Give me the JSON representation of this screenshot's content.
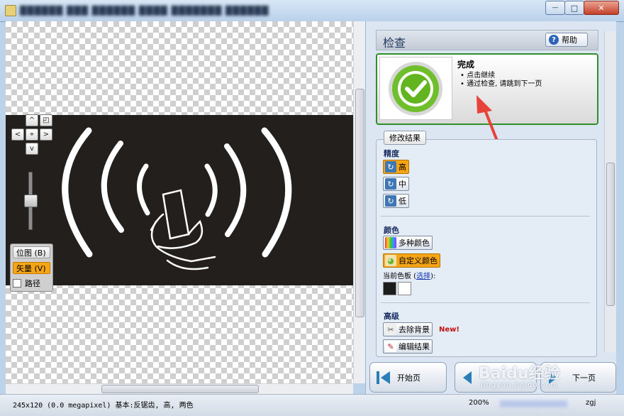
{
  "window": {
    "title": "██████ ███ ██████ ████ ███████ ██████",
    "controls": {
      "minimize": "—",
      "maximize": "□",
      "close": "✕"
    }
  },
  "canvas": {
    "pan_up": "^",
    "pan_left": "<",
    "pan_fit": "⌖",
    "pan_right": ">",
    "pan_down": "v",
    "zoom_box": "◰",
    "zoom_level": 0.6,
    "modes": [
      {
        "label": "位图 (B)",
        "active": false
      },
      {
        "label": "矢量 (V)",
        "active": true
      },
      {
        "label": "路径",
        "checked": false
      }
    ]
  },
  "panel": {
    "title": "检查",
    "help_label": "帮助",
    "done": {
      "title": "完成",
      "bullets": [
        "点击继续",
        "通过检查, 请跳到下一页"
      ]
    },
    "results_label": "修改结果",
    "precision": {
      "label": "精度",
      "options": [
        {
          "label": "高",
          "selected": true
        },
        {
          "label": "中",
          "selected": false
        },
        {
          "label": "低",
          "selected": false
        }
      ]
    },
    "color": {
      "label": "颜色",
      "multi_label": "多种颜色",
      "custom_label": "自定义颜色",
      "palette_prefix": "当前色板 (",
      "palette_link": "选择",
      "palette_suffix": "):",
      "swatches": [
        "#1c1c1c",
        "#ffffff"
      ]
    },
    "advanced": {
      "label": "高级",
      "remove_bg_label": "去除背景",
      "new_badge": "New!",
      "edit_label": "编辑结果"
    }
  },
  "nav": {
    "start_label": "开始页",
    "next_label": "下一页"
  },
  "watermark": {
    "main": "Baidu经验",
    "sub": "jingyan.baidu.com"
  },
  "status": {
    "info": "245x120 (0.0 megapixel)  基本:反锯齿, 高, 两色",
    "zoom": "200%",
    "user": "zgj"
  },
  "colors": {
    "accent_orange": "#f6a516",
    "done_green": "#2f8f2a",
    "arrow_red": "#e8433b"
  }
}
